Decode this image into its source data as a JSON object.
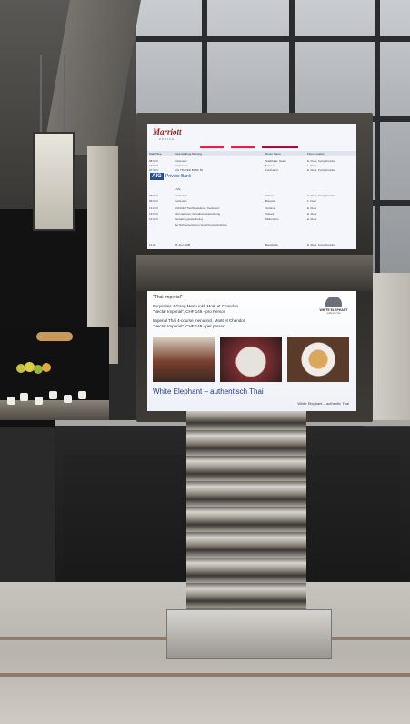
{
  "photo": {
    "top_screen": {
      "hotel_logo": "Marriott",
      "hotel_sub": "ZÜRICH",
      "bar_colors": [
        "#c6314a",
        "#c6314a",
        "#8a1e3a"
      ],
      "col_time": "Start Time",
      "col_event": "Veranstaltung Morning",
      "col_room": "Room Name",
      "col_location": "Floor Location",
      "rows": [
        {
          "time": "08:00 h",
          "event": "Konferenz",
          "room": "Stadthalle, Seats",
          "loc": "E. Floor, Konigsbrucke"
        },
        {
          "time": "13:00 h",
          "event": "Konferenz",
          "room": "Nieuen",
          "loc": "1. Floor"
        },
        {
          "time": "07:30 h",
          "event": "AIG TRAVER BANK 56",
          "room": "Ferdinand",
          "loc": "E. Floor, Konigsbrucke"
        }
      ],
      "aig_label": "AIG",
      "aig_text": "Private Bank",
      "rows2": [
        {
          "time": "",
          "event": "LIVE",
          "room": "",
          "loc": ""
        },
        {
          "time": "08:00 h",
          "event": "Konferenz",
          "room": "Clisora",
          "loc": "E. Floor, Konigsbrucke"
        },
        {
          "time": "09:00 h",
          "event": "Konferenz",
          "room": "Bisseldo",
          "loc": "1. Floor"
        },
        {
          "time": "12:00 h",
          "event": "CONCEP Tischbestellung, Konferenz",
          "room": "Carlsruu",
          "loc": "E. Floor"
        },
        {
          "time": "13:00 h",
          "event": "Informationen Verwaltungsratssitzung",
          "room": "Clisora",
          "loc": "E. Floor"
        },
        {
          "time": "14:00 h",
          "event": "Verwaltungsratssitzung",
          "room": "Millennium",
          "loc": "E. Floor"
        },
        {
          "time": "",
          "event": "der Schweizerischen Versicherungsinstitute",
          "room": "",
          "loc": ""
        }
      ],
      "footer_time": "11:20",
      "footer_date": "25 Juni 2008",
      "footer_room": "Bandstelle",
      "footer_loc": "E. Floor, Konigsbrucke"
    },
    "bottom_screen": {
      "title": "\"Thai Imperial\"",
      "line1": "Exquisites 4 Gang Menu inkl. Moët et Chandon",
      "line2": "\"Nectar Imperial\", CHF 149.- pro Person",
      "line3": "Imperial Thai 4-course menu incl. Moët et Chandon",
      "line4": "\"Nectar Imperial\", CHF 149.- per person",
      "logo_text": "WHITE ELEPHANT",
      "logo_sub": "authentic thai",
      "tagline": "White Elephant – authentisch Thai",
      "footer": "White Elephant – authentic Thai"
    }
  }
}
